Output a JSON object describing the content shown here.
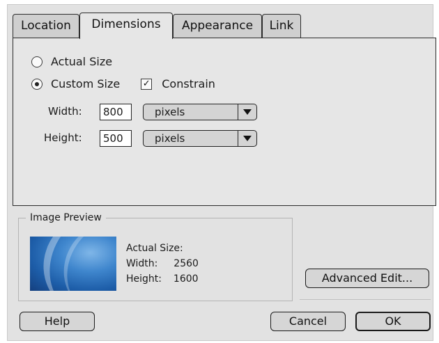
{
  "tabs": [
    {
      "label": "Location",
      "active": false
    },
    {
      "label": "Dimensions",
      "active": true
    },
    {
      "label": "Appearance",
      "active": false
    },
    {
      "label": "Link",
      "active": false
    }
  ],
  "size": {
    "actual_label": "Actual Size",
    "actual_selected": false,
    "custom_label": "Custom Size",
    "custom_selected": true,
    "constrain_label": "Constrain",
    "constrain_checked": true
  },
  "width": {
    "label": "Width:",
    "value": "800",
    "unit": "pixels"
  },
  "height": {
    "label": "Height:",
    "value": "500",
    "unit": "pixels"
  },
  "preview": {
    "title": "Image Preview",
    "actual_label": "Actual Size:",
    "width_label": "Width:",
    "width_value": "2560",
    "height_label": "Height:",
    "height_value": "1600"
  },
  "buttons": {
    "advanced": "Advanced Edit...",
    "help": "Help",
    "cancel": "Cancel",
    "ok": "OK"
  }
}
